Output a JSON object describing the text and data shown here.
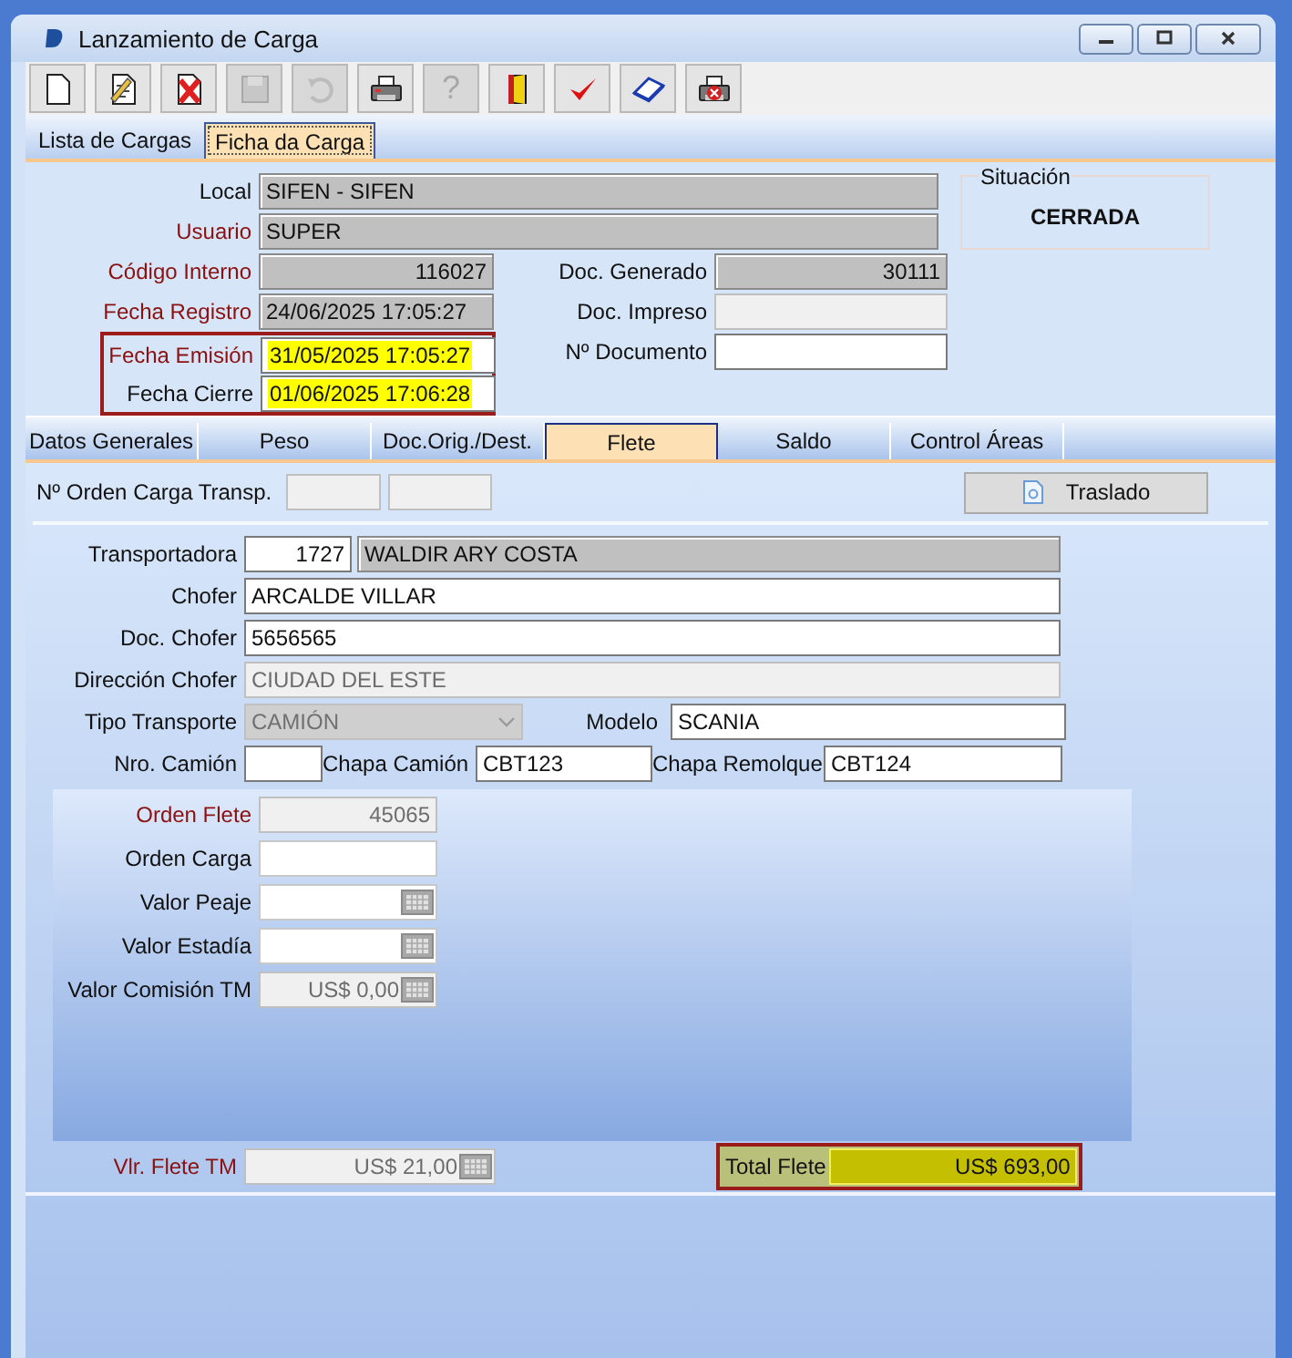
{
  "window": {
    "title": "Lanzamiento de Carga"
  },
  "toolbar": [
    {
      "kind": "new",
      "disabled": false
    },
    {
      "kind": "edit",
      "disabled": false
    },
    {
      "kind": "delete",
      "disabled": false
    },
    {
      "kind": "save",
      "disabled": true
    },
    {
      "kind": "undo",
      "disabled": true
    },
    {
      "kind": "print",
      "disabled": false
    },
    {
      "kind": "help",
      "label": "?",
      "disabled": true
    },
    {
      "kind": "exit",
      "disabled": false
    },
    {
      "kind": "confirm",
      "disabled": false
    },
    {
      "kind": "book",
      "disabled": false
    },
    {
      "kind": "print-cancel",
      "disabled": false
    }
  ],
  "tabs": [
    {
      "label": "Lista de Cargas",
      "selected": false
    },
    {
      "label": "Ficha da Carga",
      "selected": true
    }
  ],
  "header": {
    "top_fields": [
      {
        "label": "Local",
        "required": false,
        "field": {
          "value": "SIFEN - SIFEN",
          "kind": "readonly"
        }
      },
      {
        "label": "Usuario",
        "required": true,
        "field": {
          "value": "SUPER",
          "kind": "readonly"
        }
      }
    ],
    "left_fields": [
      {
        "label": "Código Interno",
        "required": true,
        "field": {
          "value": "116027",
          "kind": "readonly",
          "numeric": true
        }
      },
      {
        "label": "Fecha Registro",
        "required": true,
        "field": {
          "value": "24/06/2025 17:05:27",
          "kind": "readonly"
        }
      }
    ],
    "marked_fields": [
      {
        "label": "Fecha Emisión",
        "required": true,
        "field": {
          "value": "31/05/2025 17:05:27",
          "kind": "input",
          "highlighted": true
        }
      },
      {
        "label": "Fecha Cierre",
        "required": false,
        "field": {
          "value": "01/06/2025 17:06:28",
          "kind": "input",
          "highlighted": true
        }
      }
    ],
    "right_fields": [
      {
        "label": "Doc. Generado",
        "required": false,
        "field": {
          "value": "30111",
          "kind": "readonly",
          "numeric": true
        }
      },
      {
        "label": "Doc. Impreso",
        "required": false,
        "field": {
          "kind": "disabled"
        }
      },
      {
        "label": "Nº Documento",
        "required": false,
        "field": {
          "kind": "input"
        }
      }
    ],
    "status": {
      "label": "Situación",
      "value": "CERRADA"
    }
  },
  "subtabs": [
    {
      "label": "Datos Generales",
      "selected": false
    },
    {
      "label": "Peso",
      "selected": false
    },
    {
      "label": "Doc.Orig./Dest.",
      "selected": false
    },
    {
      "label": "Flete",
      "selected": true
    },
    {
      "label": "Saldo",
      "selected": false
    },
    {
      "label": "Control Áreas",
      "selected": false
    }
  ],
  "flete": {
    "order": {
      "label": "Nº Orden Carga Transp.",
      "fields": [
        {
          "kind": "disabled"
        },
        {
          "kind": "disabled"
        }
      ]
    },
    "traslado_button": {
      "label": "Traslado"
    },
    "transportadora": {
      "label": "Transportadora",
      "required": false,
      "code": {
        "value": "1727",
        "kind": "input",
        "numeric": true
      },
      "name": {
        "value": "WALDIR ARY COSTA",
        "kind": "readonly"
      }
    },
    "chofer": {
      "label": "Chofer",
      "required": false,
      "field": {
        "value": "ARCALDE VILLAR",
        "kind": "input"
      }
    },
    "doc_chofer": {
      "label": "Doc. Chofer",
      "required": false,
      "field": {
        "value": "5656565",
        "kind": "input"
      }
    },
    "direccion": {
      "label": "Dirección Chofer",
      "required": false,
      "field": {
        "value": "CIUDAD DEL ESTE",
        "kind": "disabled"
      }
    },
    "tipo": {
      "label": "Tipo Transporte",
      "required": false,
      "field": {
        "value": "CAMIÓN",
        "kind": "combo"
      }
    },
    "modelo": {
      "label": "Modelo",
      "required": false,
      "field": {
        "value": "SCANIA",
        "kind": "input"
      }
    },
    "nro_camion": {
      "label": "Nro. Camión",
      "required": false,
      "field": {
        "kind": "input"
      }
    },
    "chapa_camion": {
      "label": "Chapa Camión",
      "required": false,
      "field": {
        "value": "CBT123",
        "kind": "input"
      }
    },
    "chapa_remolque": {
      "label": "Chapa Remolque",
      "required": false,
      "field": {
        "value": "CBT124",
        "kind": "input"
      }
    },
    "values": [
      {
        "label": "Orden Flete",
        "required": true,
        "field": {
          "value": "45065",
          "kind": "disabled",
          "numeric": true
        }
      },
      {
        "label": "Orden Carga",
        "required": false,
        "field": {
          "kind": "light"
        }
      },
      {
        "label": "Valor Peaje",
        "required": false,
        "field": {
          "kind": "light",
          "calculator": true
        }
      },
      {
        "label": "Valor Estadía",
        "required": false,
        "field": {
          "kind": "light",
          "calculator": true
        }
      },
      {
        "label": "Valor Comisión TM",
        "required": false,
        "field": {
          "value": "US$ 0,00",
          "kind": "disabled",
          "numeric": true,
          "calculator": true
        }
      }
    ],
    "vlr_flete": {
      "label": "Vlr. Flete TM",
      "required": true,
      "field": {
        "value": "US$ 21,00",
        "kind": "disabled",
        "numeric": true,
        "calculator": true
      }
    },
    "total": {
      "label": "Total Flete",
      "field": {
        "value": "US$ 693,00",
        "kind": "total",
        "numeric": true
      }
    }
  }
}
